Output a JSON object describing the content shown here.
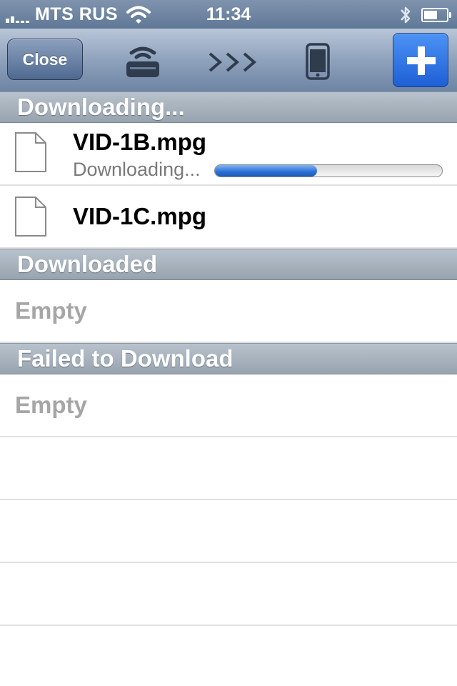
{
  "status_bar": {
    "carrier": "MTS RUS",
    "time": "11:34",
    "battery_level": 0.6,
    "icons": [
      "signal-icon",
      "wifi-icon",
      "bluetooth-icon",
      "battery-icon"
    ]
  },
  "toolbar": {
    "close_label": "Close",
    "icons": [
      "wifi-router-icon",
      "transfer-arrows-icon",
      "phone-icon",
      "plus-icon"
    ],
    "arrows_text": ">>>",
    "accent_color": "#2a6be0"
  },
  "sections": {
    "downloading": {
      "title": "Downloading...",
      "items": [
        {
          "name": "VID-1B.mpg",
          "status": "Downloading...",
          "progress": 0.45
        },
        {
          "name": "VID-1C.mpg"
        }
      ]
    },
    "downloaded": {
      "title": "Downloaded",
      "empty_label": "Empty"
    },
    "failed": {
      "title": "Failed to Download",
      "empty_label": "Empty"
    }
  }
}
